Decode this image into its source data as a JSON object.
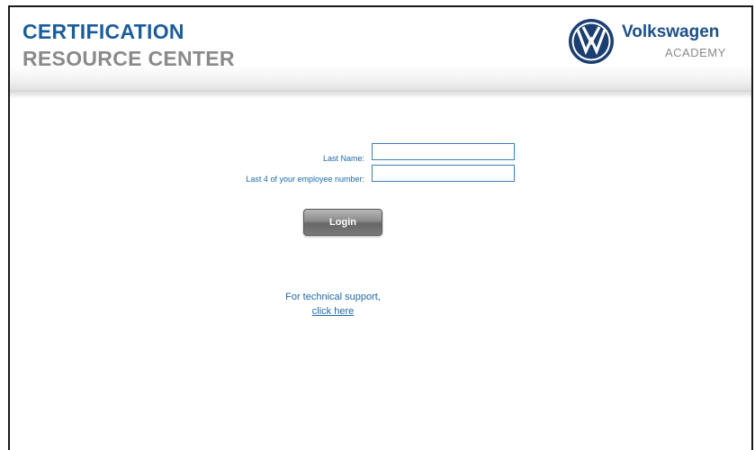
{
  "header": {
    "title_line1": "CERTIFICATION",
    "title_line2": "RESOURCE CENTER",
    "brand_name": "Volkswagen",
    "brand_sub": "ACADEMY",
    "logo_icon": "vw-logo-icon"
  },
  "login_form": {
    "last_name_label": "Last Name:",
    "last_name_value": "",
    "employee_label": "Last 4 of your employee number:",
    "employee_value": "",
    "login_button": "Login"
  },
  "support": {
    "text": "For technical support,",
    "link": "click here"
  },
  "colors": {
    "brand_blue": "#1b5d9c",
    "label_blue": "#1e6aa8",
    "gray_text": "#8a8a8a",
    "input_border": "#3d7fb7"
  }
}
